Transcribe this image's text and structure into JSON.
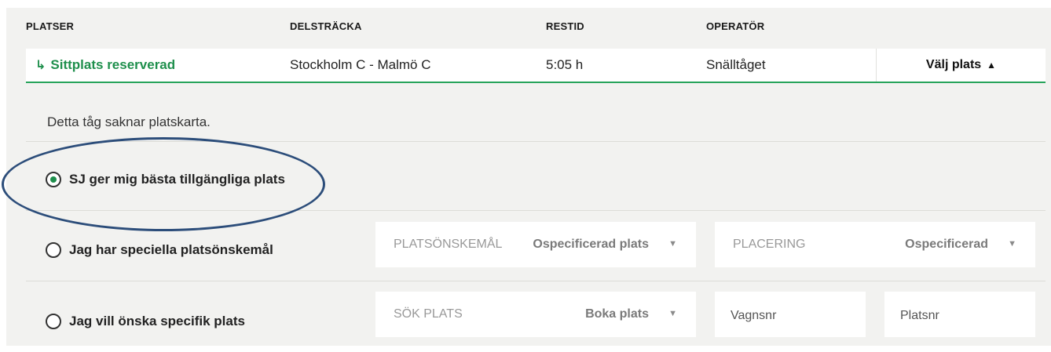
{
  "headers": {
    "platser": "PLATSER",
    "delstracka": "DELSTRÄCKA",
    "restid": "RESTID",
    "operator": "OPERATÖR"
  },
  "summary": {
    "seat_status_icon": "↳",
    "seat_status": "Sittplats reserverad",
    "route": "Stockholm C - Malmö C",
    "travel_time": "5:05 h",
    "operator": "Snälltåget",
    "choose_seat": "Välj plats",
    "choose_seat_icon": "▲"
  },
  "note": "Detta tåg saknar platskarta.",
  "options": [
    {
      "label": "SJ ger mig bästa tillgängliga plats",
      "selected": true
    },
    {
      "label": "Jag har speciella platsönskemål",
      "selected": false
    },
    {
      "label": "Jag vill önska specifik plats",
      "selected": false
    }
  ],
  "seat_wish": {
    "label": "PLATSÖNSKEMÅL",
    "value": "Ospecificerad plats",
    "caret": "▼"
  },
  "placement": {
    "label": "PLACERING",
    "value": "Ospecificerad",
    "caret": "▼"
  },
  "search_seat": {
    "label": "SÖK PLATS",
    "value": "Boka plats",
    "caret": "▼"
  },
  "car_number": {
    "placeholder": "Vagnsnr"
  },
  "seat_number": {
    "placeholder": "Platsnr"
  },
  "colors": {
    "accent_green": "#1e8f4c",
    "annotation_blue": "#2c4d7a"
  }
}
